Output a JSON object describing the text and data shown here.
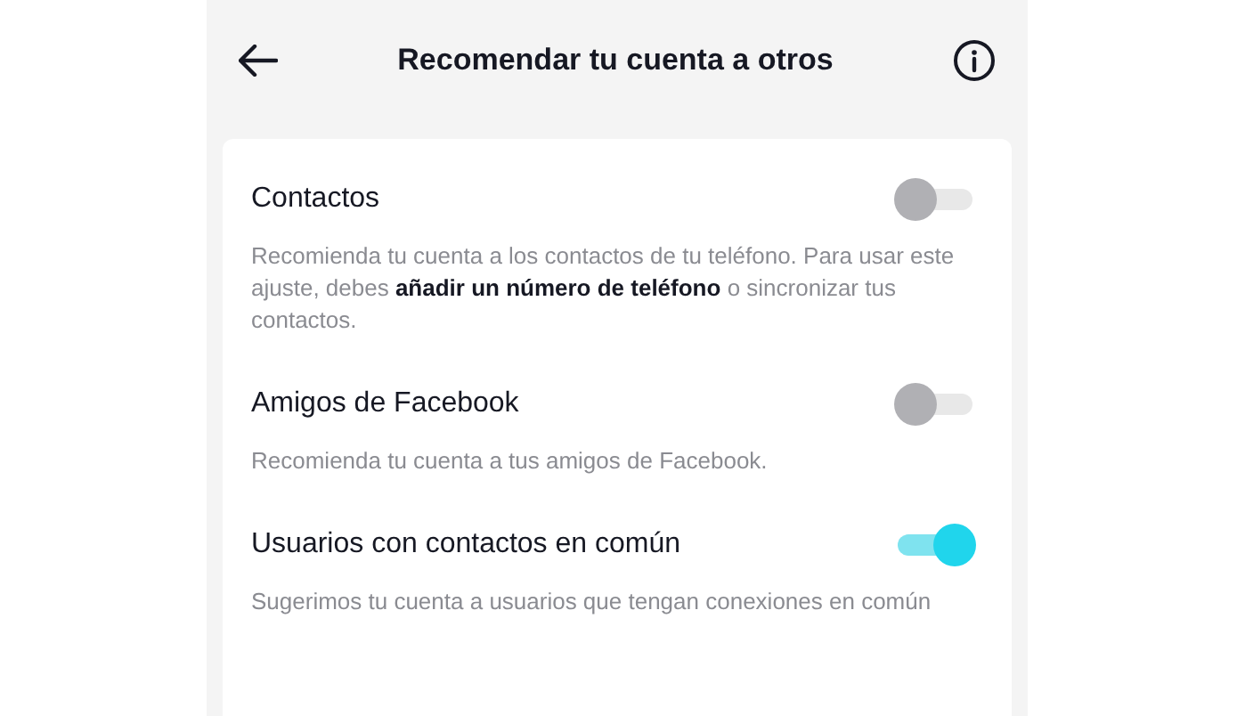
{
  "header": {
    "title": "Recomendar tu cuenta a otros"
  },
  "settings": [
    {
      "label": "Contactos",
      "description": "Recomienda tu cuenta a los contactos de tu teléfono. Para usar este ajuste, debes **añadir un número de teléfono** o sincronizar tus contactos.",
      "on": false
    },
    {
      "label": "Amigos de Facebook",
      "description": "Recomienda tu cuenta a tus amigos de Facebook.",
      "on": false
    },
    {
      "label": "Usuarios con contactos en común",
      "description": "Sugerimos tu cuenta a usuarios que tengan conexiones en común",
      "on": true
    }
  ]
}
